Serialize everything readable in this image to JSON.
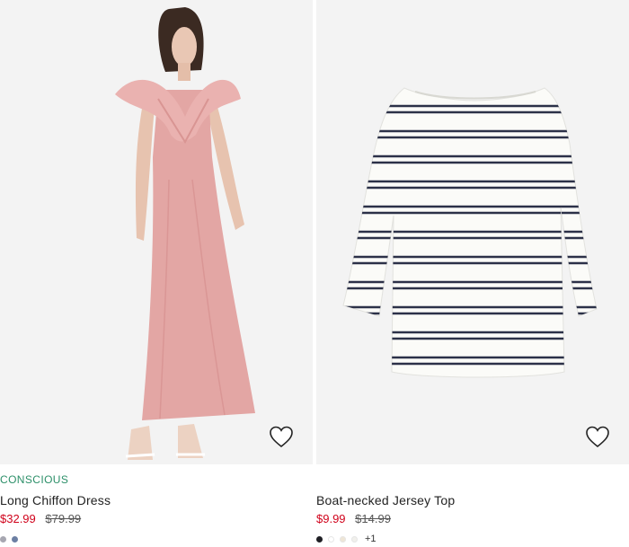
{
  "products": [
    {
      "tag": "CONSCIOUS",
      "name": "Long Chiffon Dress",
      "price": "$32.99",
      "old_price": "$79.99",
      "image_icon": "pink-chiffon-dress-photo",
      "swatches": [
        "#a7a7b1",
        "#6c7fa3"
      ],
      "more": ""
    },
    {
      "tag": "",
      "name": "Boat-necked Jersey Top",
      "price": "$9.99",
      "old_price": "$14.99",
      "image_icon": "striped-jersey-top-photo",
      "swatches": [
        "#1f1f24",
        "#ffffff",
        "#efe6d6",
        "#f1f0ec"
      ],
      "more": "+1"
    }
  ],
  "colors": {
    "accent_green": "#2b8f68",
    "sale_red": "#d0021b"
  }
}
